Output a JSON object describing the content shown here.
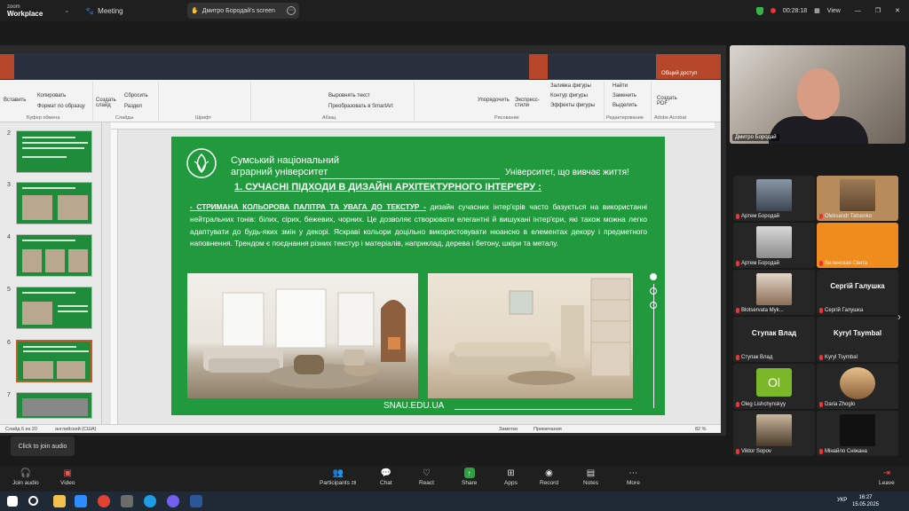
{
  "topbar": {
    "brand_top": "zoom",
    "brand_bottom": "Workplace",
    "meeting_label": "Meeting",
    "share_label": "Дмитро Бородай's screen",
    "timer": "00:28:18",
    "view_label": "View"
  },
  "ppt": {
    "share_access": "Общий доступ",
    "ribbon": {
      "paste": "Вставить",
      "copy": "Копировать",
      "format_painter": "Формат по образцу",
      "new_slide": "Создать слайд",
      "reset": "Сбросить",
      "section": "Раздел",
      "align_text": "Выровнять текст",
      "smartart": "Преобразовать в SmartArt",
      "arrange": "Упорядочить",
      "express": "Экспресс-стили",
      "fill": "Заливка фигуры",
      "outline": "Контур фигуры",
      "effects": "Эффекты фигуры",
      "find": "Найти",
      "replace": "Заменить",
      "select": "Выделить",
      "create_pdf": "Создать PDF",
      "groups": {
        "clipboard": "Буфер обмена",
        "slides": "Слайды",
        "font": "Шрифт",
        "paragraph": "Абзац",
        "drawing": "Рисование",
        "editing": "Редактирование",
        "acrobat": "Adobe Acrobat"
      }
    },
    "thumb_numbers": [
      "2",
      "3",
      "4",
      "5",
      "6",
      "7"
    ],
    "status": {
      "slide": "Слайд 6 из 20",
      "language": "английский (США)",
      "notes": "Заметки",
      "comments": "Примечания",
      "zoom": "82 %"
    }
  },
  "slide": {
    "uni_line1": "Сумський національний",
    "uni_line2": "аграрний університет",
    "slogan": "Університет, що вивчає життя!",
    "heading": "1. СУЧАСНІ ПІДХОДИ В ДИЗАЙНІ АРХІТЕКТУРНОГО ІНТЕР'ЄРУ :",
    "lead": "- СТРИМАНА КОЛЬОРОВА ПАЛІТРА ТА УВАГА ДО ТЕКСТУР -",
    "body": " дизайн сучасних інтер'єрів часто базується на використанні нейтральних тонів: білих, сірих, бежевих, чорних. Це дозволяє створювати елегантні й вишукані інтер'єри, які також можна легко адаптувати до будь-яких змін у декорі. Яскраві кольори доцільно використовувати нюансно в елементах декору і предметного наповнення. Трендом є поєднання різних текстур і матеріалів, наприклад, дерева і бетону, шкіри та металу.",
    "site": "SNAU.EDU.UA"
  },
  "participants": {
    "self_name": "Дмитро Бородай",
    "tiles": [
      {
        "name": "Артем Бородай",
        "big": ""
      },
      {
        "name": "Oleksandr Tatsenko",
        "big": ""
      },
      {
        "name": "Артем Бородай",
        "big": ""
      },
      {
        "name": "Виленская Света",
        "big": ""
      },
      {
        "name": "Blotservata Myk...",
        "big": ""
      },
      {
        "name": "Сергій Галушка",
        "big": "Сергій Галушка"
      },
      {
        "name": "Ступак Влад",
        "big": "Ступак Влад"
      },
      {
        "name": "Kyryl Tsymbal",
        "big": "Kyryl Tsymbal"
      },
      {
        "name": "Oleg Lishchynskyy",
        "big": "Ol"
      },
      {
        "name": "Daria Zhoglo",
        "big": ""
      },
      {
        "name": "Viktor Sopov",
        "big": ""
      },
      {
        "name": "Мінайло Сніжана",
        "big": ""
      }
    ]
  },
  "toolbar": {
    "tooltip": "Click to join audio",
    "join_audio": "Join audio",
    "video": "Video",
    "participants": "Participants",
    "participants_count": "28",
    "chat": "Chat",
    "react": "React",
    "share": "Share",
    "apps": "Apps",
    "record": "Record",
    "notes": "Notes",
    "more": "More",
    "leave": "Leave"
  },
  "taskbar": {
    "lang": "УКР",
    "time": "16:27",
    "date": "15.05.2025"
  },
  "colors": {
    "slide_green": "#219a3d",
    "ppt_accent": "#b7472a",
    "share_green": "#2ea043"
  }
}
